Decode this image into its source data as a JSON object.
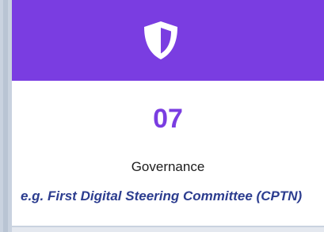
{
  "card": {
    "number": "07",
    "label": "Governance",
    "example": "e.g. First Digital Steering Committee (CPTN)",
    "icon": "shield-icon"
  },
  "colors": {
    "accent": "#7a3de1",
    "example_text": "#2c3d8f",
    "body_text": "#1c1c1c"
  }
}
